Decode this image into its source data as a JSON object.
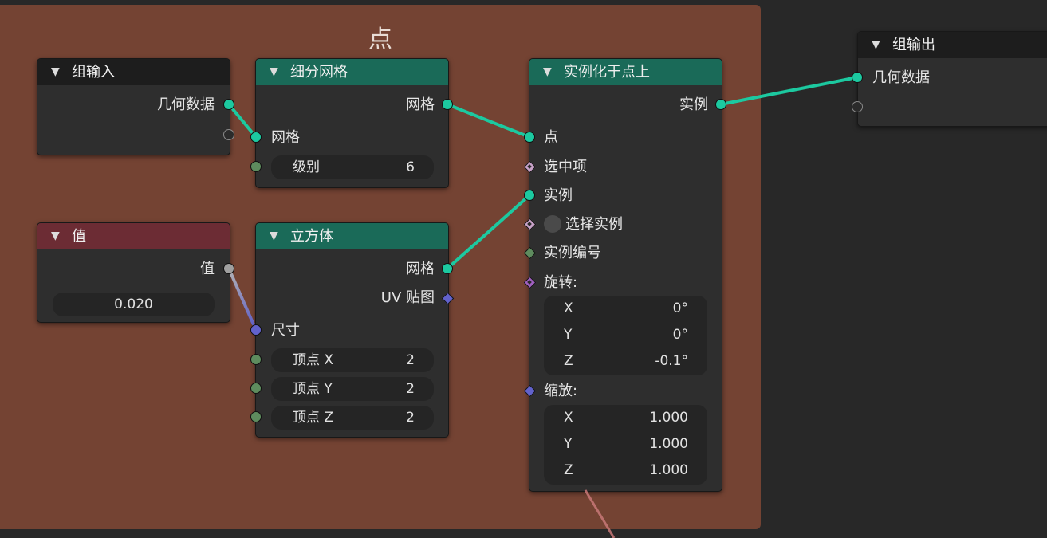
{
  "frame": {
    "title": "点"
  },
  "colors": {
    "frame_bg": "#744333",
    "geometry_socket": "#1cc9a0",
    "int_socket": "#5e8c5e",
    "vector_socket": "#6262cc",
    "bool_socket": "#c8a2c8",
    "rotation_socket": "#a060c0",
    "float_socket": "#a0a0a0"
  },
  "nodes": {
    "group_input": {
      "title": "组输入",
      "out_geometry": "几何数据"
    },
    "subdivide": {
      "title": "细分网格",
      "out_mesh": "网格",
      "in_mesh": "网格",
      "level_label": "级别",
      "level_value": "6"
    },
    "value": {
      "title": "值",
      "out_value": "值",
      "value": "0.020"
    },
    "cube": {
      "title": "立方体",
      "out_mesh": "网格",
      "out_uv": "UV 贴图",
      "in_size": "尺寸",
      "verts_x_label": "顶点 X",
      "verts_x": "2",
      "verts_y_label": "顶点 Y",
      "verts_y": "2",
      "verts_z_label": "顶点 Z",
      "verts_z": "2"
    },
    "instance_on_points": {
      "title": "实例化于点上",
      "out_instances": "实例",
      "in_points": "点",
      "in_selection": "选中项",
      "in_instance": "实例",
      "in_pick_instance": "选择实例",
      "in_instance_index": "实例编号",
      "rotation_label": "旋转:",
      "rotation": {
        "x_label": "X",
        "x": "0°",
        "y_label": "Y",
        "y": "0°",
        "z_label": "Z",
        "z": "-0.1°"
      },
      "scale_label": "缩放:",
      "scale": {
        "x_label": "X",
        "x": "1.000",
        "y_label": "Y",
        "y": "1.000",
        "z_label": "Z",
        "z": "1.000"
      }
    },
    "group_output": {
      "title": "组输出",
      "in_geometry": "几何数据"
    }
  },
  "links": [
    {
      "from": "group_input.geometry",
      "to": "subdivide.mesh",
      "kind": "geometry"
    },
    {
      "from": "subdivide.mesh",
      "to": "instance_on_points.points",
      "kind": "geometry"
    },
    {
      "from": "cube.mesh",
      "to": "instance_on_points.instance",
      "kind": "geometry"
    },
    {
      "from": "value.value",
      "to": "cube.size",
      "kind": "float-to-vector"
    },
    {
      "from": "instance_on_points.instances",
      "to": "group_output.geometry",
      "kind": "geometry"
    }
  ]
}
